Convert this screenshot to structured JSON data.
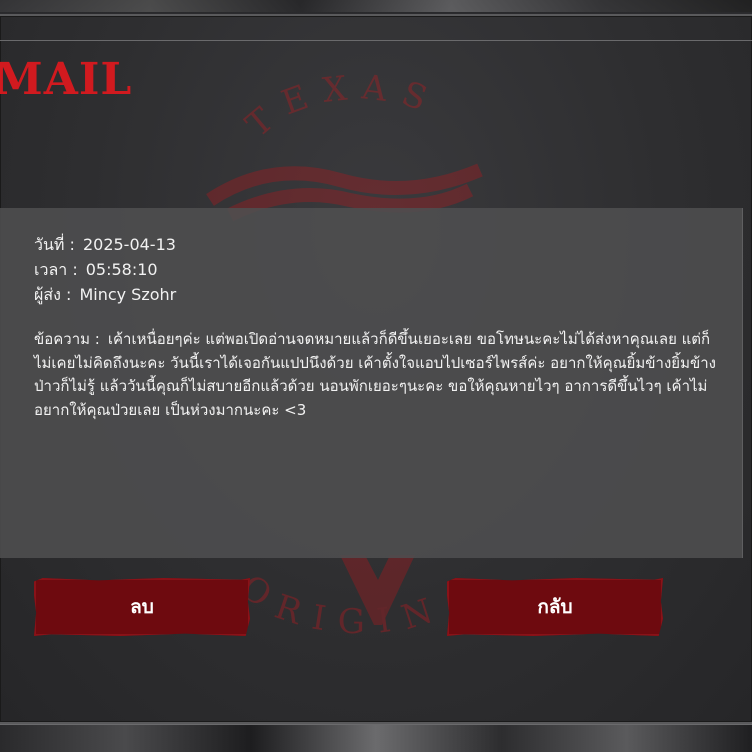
{
  "title": "MAIL",
  "emblem": {
    "top_text": "TEXAS",
    "bottom_text": "ORIGIN",
    "color": "#d11a1f"
  },
  "mail": {
    "date_label": "วันที่ :",
    "date_value": "2025-04-13",
    "time_label": "เวลา :",
    "time_value": "05:58:10",
    "sender_label": "ผู้ส่ง :",
    "sender_value": "Mincy Szohr",
    "message_label": "ข้อความ :",
    "message_text": "เค้าเหนื่อยๆค่ะ แต่พอเปิดอ่านจดหมายแล้วก็ดีขึ้นเยอะเลย ขอโทษนะคะไม่ได้ส่งหาคุณเลย แต่ก็ไม่เคยไม่คิดถึงนะคะ วันนี้เราได้เจอกันแปปนึงด้วย เค้าตั้งใจแอบไปเซอร์ไพรส์ค่ะ อยากให้คุณยิ้มข้างยิ้มข้างป่าวก็ไม่รู้ แล้ววันนี้คุณก็ไม่สบายอีกแล้วด้วย นอนพักเยอะๆนะคะ ขอให้คุณหายไวๆ อาการดีขึ้นไวๆ เค้าไม่อยากให้คุณป่วยเลย เป็นห่วงมากนะคะ <3"
  },
  "buttons": {
    "delete_label": "ลบ",
    "back_label": "กลับ"
  },
  "colors": {
    "accent": "#d11a1f",
    "button_bg": "#6e0a0f",
    "panel_bg": "#2e2e30",
    "message_bg": "#4e4e50",
    "text": "#f2f2f2"
  }
}
